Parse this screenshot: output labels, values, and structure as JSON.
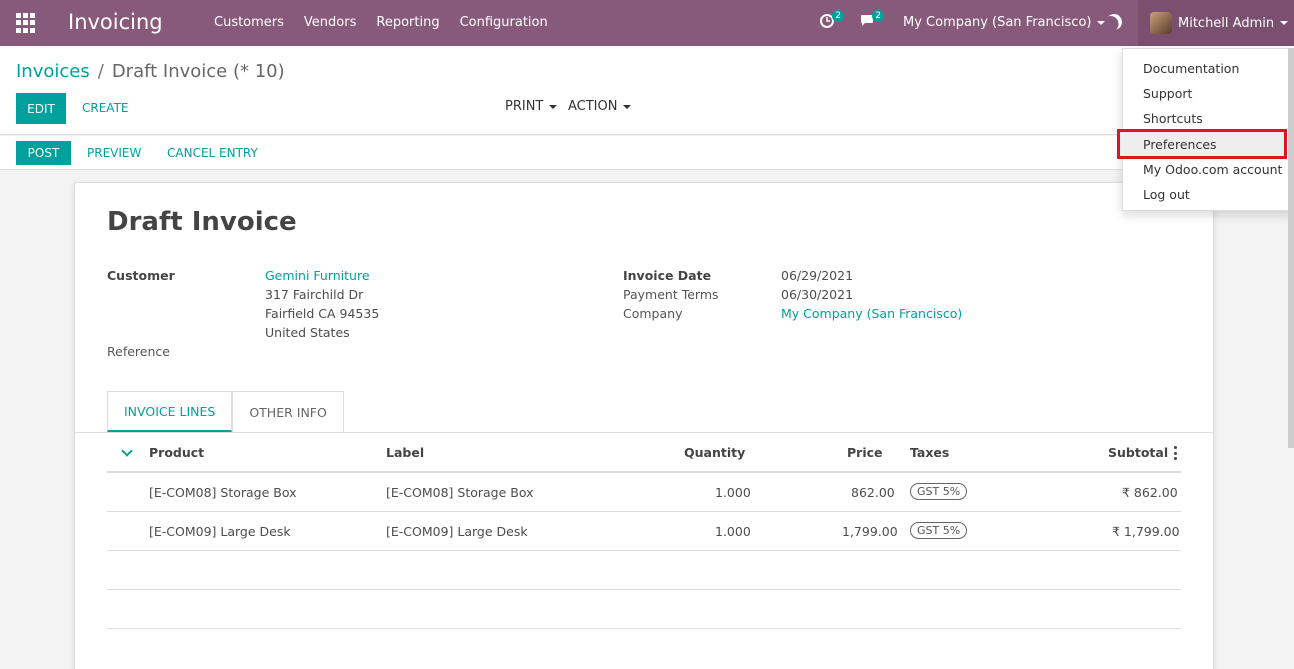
{
  "navbar": {
    "app_title": "Invoicing",
    "menu": [
      "Customers",
      "Vendors",
      "Reporting",
      "Configuration"
    ],
    "activity_badge": "2",
    "messages_badge": "2",
    "company": "My Company (San Francisco)",
    "user": "Mitchell Admin",
    "bg_color": "#875a7b"
  },
  "breadcrumb": {
    "parent": "Invoices",
    "separator": "/",
    "current": "Draft Invoice (* 10)"
  },
  "toolbar": {
    "edit": "EDIT",
    "create": "CREATE",
    "print": "PRINT",
    "action": "ACTION"
  },
  "statusbar": {
    "post": "POST",
    "preview": "PREVIEW",
    "cancel": "CANCEL ENTRY"
  },
  "invoice": {
    "title": "Draft Invoice",
    "customer_label": "Customer",
    "customer_name": "Gemini Furniture",
    "address_1": "317 Fairchild Dr",
    "address_2": "Fairfield CA 94535",
    "address_3": "United States",
    "reference_label": "Reference",
    "invoice_date_label": "Invoice Date",
    "invoice_date": "06/29/2021",
    "payment_terms_label": "Payment Terms",
    "payment_terms": "06/30/2021",
    "company_label": "Company",
    "company": "My Company (San Francisco)"
  },
  "tabs": [
    "INVOICE LINES",
    "OTHER INFO"
  ],
  "table": {
    "headers": {
      "product": "Product",
      "label": "Label",
      "quantity": "Quantity",
      "price": "Price",
      "taxes": "Taxes",
      "subtotal": "Subtotal"
    },
    "rows": [
      {
        "product": "[E-COM08] Storage Box",
        "label": "[E-COM08] Storage Box",
        "quantity": "1.000",
        "price": "862.00",
        "tax": "GST 5%",
        "subtotal": "₹ 862.00"
      },
      {
        "product": "[E-COM09] Large Desk",
        "label": "[E-COM09] Large Desk",
        "quantity": "1.000",
        "price": "1,799.00",
        "tax": "GST 5%",
        "subtotal": "₹ 1,799.00"
      }
    ]
  },
  "user_dropdown": {
    "items": [
      "Documentation",
      "Support",
      "Shortcuts",
      "Preferences",
      "My Odoo.com account",
      "Log out"
    ],
    "highlighted": "Preferences",
    "highlight_color": "#e0141e"
  }
}
